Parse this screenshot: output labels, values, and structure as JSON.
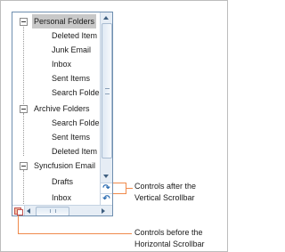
{
  "tree": {
    "folders": [
      {
        "label": "Personal Folders",
        "selected": true,
        "children": [
          "Deleted Item",
          "Junk Email",
          "Inbox",
          "Sent Items",
          "Search Folde"
        ]
      },
      {
        "label": "Archive Folders",
        "selected": false,
        "children": [
          "Search Folde",
          "Sent Items",
          "Deleted Item"
        ]
      },
      {
        "label": "Syncfusion Email",
        "selected": false,
        "children": [
          "Drafts",
          "Inbox"
        ]
      }
    ]
  },
  "scrollbars": {
    "vertical_controls": [
      {
        "icon": "redo-arrow-icon",
        "glyph": "↷"
      },
      {
        "icon": "undo-arrow-icon",
        "glyph": "↶"
      }
    ]
  },
  "callouts": {
    "vertical": [
      "Controls after the",
      "Vertical Scrollbar"
    ],
    "horizontal": [
      "Controls before the",
      "Horizontal Scrollbar"
    ]
  },
  "colors": {
    "callout_line": "#f08a4b",
    "panel_border": "#6f8fb0",
    "selected_bg": "#c8c8c8"
  }
}
